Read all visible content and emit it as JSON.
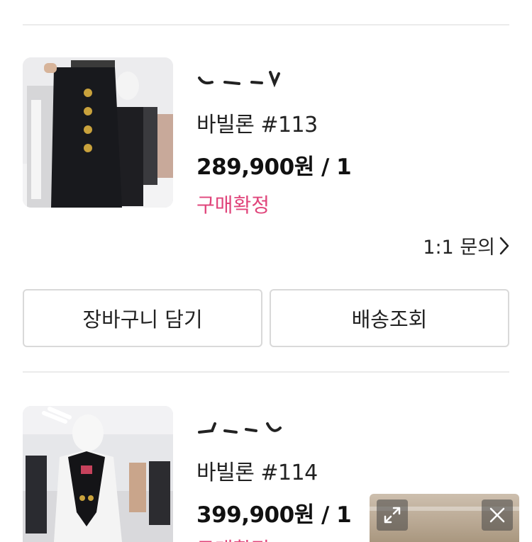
{
  "orders": [
    {
      "product_name": "바빌론 #113",
      "price": "289,900원 / 1",
      "status": "구매확정",
      "inquiry_label": "1:1 문의",
      "buttons": {
        "cart": "장바구니 담기",
        "tracking": "배송조회"
      }
    },
    {
      "product_name": "바빌론 #114",
      "price": "399,900원 / 1",
      "status": "구매확정"
    }
  ],
  "colors": {
    "status": "#e0457b",
    "button_border": "#d9d9d9",
    "divider": "#ebebeb"
  },
  "icons": {
    "inquiry_arrow": "chevron-right-icon",
    "expand": "expand-icon",
    "close": "close-icon"
  }
}
